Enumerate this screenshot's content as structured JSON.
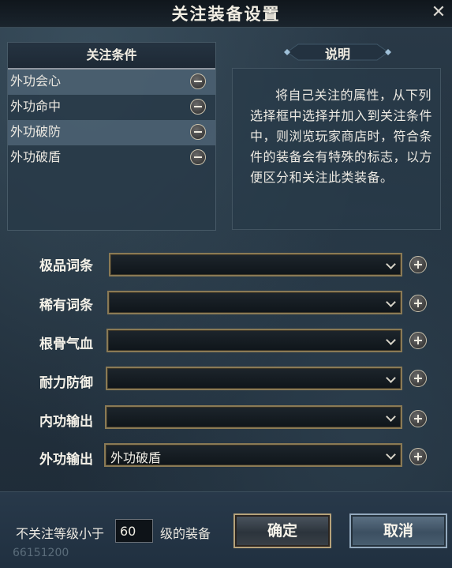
{
  "window": {
    "title": "关注装备设置"
  },
  "conditions": {
    "header": "关注条件",
    "items": [
      {
        "label": "外功会心",
        "highlighted": true
      },
      {
        "label": "外功命中",
        "highlighted": false
      },
      {
        "label": "外功破防",
        "highlighted": true
      },
      {
        "label": "外功破盾",
        "highlighted": false
      }
    ]
  },
  "description": {
    "tab_label": "说明",
    "text": "将自己关注的属性，从下列选择框中选择并加入到关注条件中，则浏览玩家商店时，符合条件的装备会有特殊的标志，以方便区分和关注此类装备。"
  },
  "filters": [
    {
      "label": "极品词条",
      "value": ""
    },
    {
      "label": "稀有词条",
      "value": ""
    },
    {
      "label": "根骨气血",
      "value": ""
    },
    {
      "label": "耐力防御",
      "value": ""
    },
    {
      "label": "内功输出",
      "value": ""
    },
    {
      "label": "外功输出",
      "value": "外功破盾"
    }
  ],
  "footer": {
    "level_prefix": "不关注等级小于",
    "level_value": "60",
    "level_suffix": "级的装备",
    "confirm_label": "确定",
    "cancel_label": "取消",
    "ghost_number": "66151200"
  },
  "colors": {
    "background": "#1f2d3b",
    "gold_border": "#8a7a55",
    "highlight_row": "#6e879b"
  }
}
